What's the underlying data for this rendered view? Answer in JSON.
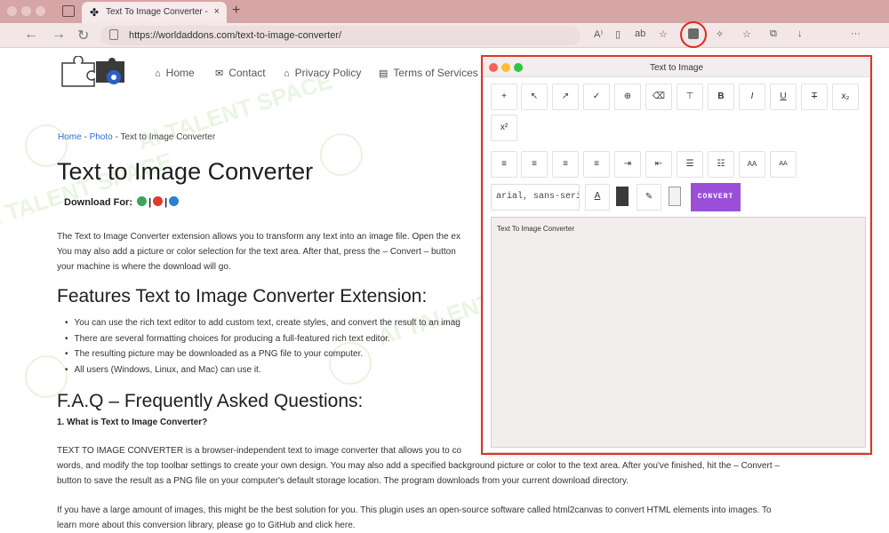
{
  "browser": {
    "tab_title": "Text To Image Converter - Wor",
    "tab_close": "×",
    "new_tab": "+",
    "url": "https://worldaddons.com/text-to-image-converter/"
  },
  "site": {
    "nav": [
      "Home",
      "Contact",
      "Privacy Policy",
      "Terms of Services"
    ],
    "breadcrumb": {
      "home": "Home",
      "sep1": " - ",
      "photo": "Photo",
      "sep2": " - ",
      "current": "Text to Image Converter"
    },
    "title": "Text to Image Converter",
    "download_label": "Download For:",
    "intro_lines": [
      "The Text to Image Converter extension allows you to transform any text into an image file. Open the ex",
      "You may also add a picture or color selection for the text area. After that, press the – Convert – button",
      "your machine is where the download will go."
    ],
    "features_heading": "Features Text to Image Converter Extension:",
    "features": [
      "You can use the rich text editor to add custom text, create styles, and convert the result to an imag",
      "There are several formatting choices for producing a full-featured rich text editor.",
      "The resulting picture may be downloaded as a PNG file to your computer.",
      "All users (Windows, Linux, and Mac) can use it."
    ],
    "faq_heading": "F.A.Q – Frequently Asked Questions:",
    "faq_q1": "1. What is Text to Image Converter?",
    "faq_a1": [
      "TEXT TO IMAGE CONVERTER is a browser-independent text to image converter that allows you to co",
      "words, and modify the top toolbar settings to create your own design. You may also add a specified background picture or color to the text area. After you've finished, hit the – Convert –",
      "button to save the result as a PNG file on your computer's default storage location. The program downloads from your current download directory."
    ],
    "faq_a2": [
      "If you have a large amount of images, this might be the best solution for you. This plugin uses an open-source software called html2canvas to convert HTML elements into images. To",
      "learn more about this conversion library, please go to GitHub and click here."
    ],
    "watermark": "AI TALENT SPACE"
  },
  "popup": {
    "title": "Text to Image",
    "row1": [
      "+",
      "↖",
      "↗",
      "✓",
      "⊕",
      "⌫",
      "⊤",
      "B",
      "I",
      "U",
      "T",
      "x₂"
    ],
    "row1b": [
      "x²"
    ],
    "row2": [
      "≡",
      "≡",
      "≡",
      "≡",
      "⇥",
      "⇤",
      "☰",
      "☷",
      "AA",
      "AA"
    ],
    "font_value": "arial, sans-serif",
    "color_letter": "A",
    "pen": "✎",
    "convert_label": "CONVERT",
    "editor_text": "Text To Image Converter"
  }
}
